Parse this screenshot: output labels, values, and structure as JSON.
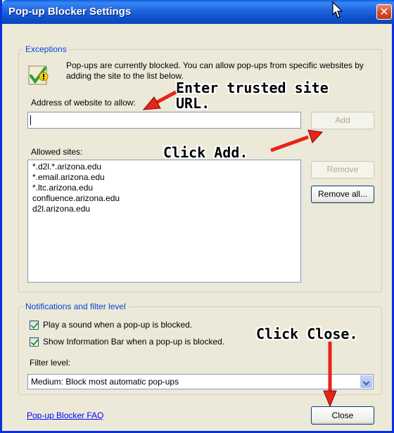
{
  "window": {
    "title": "Pop-up Blocker Settings",
    "close_glyph": "✕"
  },
  "exceptions": {
    "legend": "Exceptions",
    "info_text": "Pop-ups are currently blocked.  You can allow pop-ups from specific websites by adding the site to the list below.",
    "address_label": "Address of website to allow:",
    "address_value": "",
    "add_label": "Add",
    "allowed_label": "Allowed sites:",
    "allowed_sites": [
      "*.d2l.*.arizona.edu",
      "*.email.arizona.edu",
      "*.ltc.arizona.edu",
      "confluence.arizona.edu",
      "d2l.arizona.edu"
    ],
    "remove_label": "Remove",
    "remove_all_label": "Remove all..."
  },
  "notifications": {
    "legend": "Notifications and filter level",
    "play_sound_label": "Play a sound when a pop-up is blocked.",
    "play_sound_checked": true,
    "show_info_bar_label": "Show Information Bar when a pop-up is blocked.",
    "show_info_bar_checked": true,
    "filter_label": "Filter level:",
    "filter_value": "Medium: Block most automatic pop-ups"
  },
  "footer": {
    "faq_link": "Pop-up Blocker FAQ",
    "close_label": "Close"
  },
  "annotations": {
    "enter_url": "Enter trusted site\nURL.",
    "click_add": "Click Add.",
    "click_close": "Click Close."
  },
  "icons": {
    "window_close": "close-icon",
    "info": "shield-check-icon",
    "cursor": "mouse-pointer-icon"
  },
  "colors": {
    "titlebar": "#0a47b8",
    "legend": "#0046d5",
    "annotation_arrow": "#e8231a",
    "link": "#0000ff"
  }
}
